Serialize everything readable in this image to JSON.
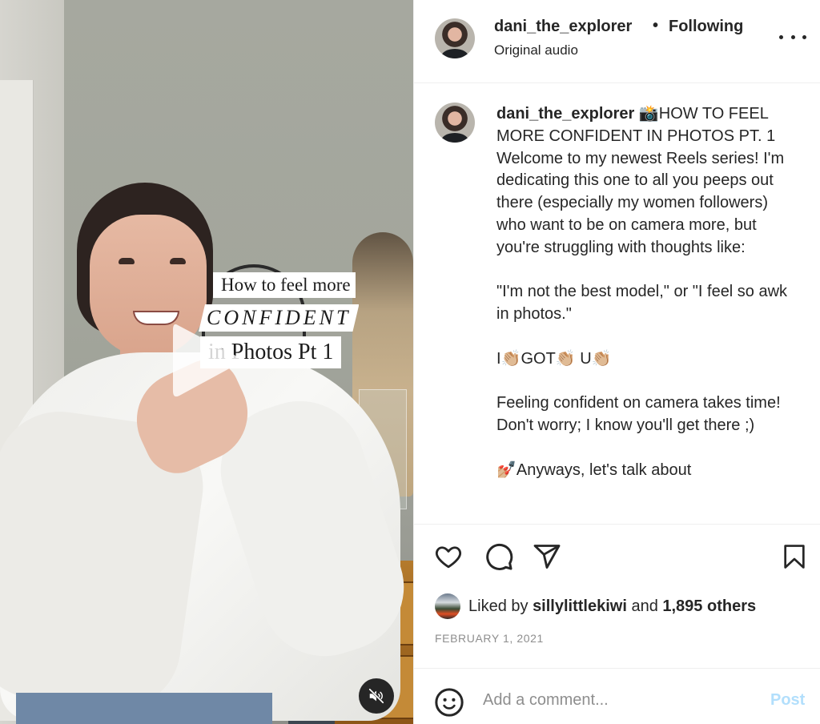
{
  "video": {
    "overlay_lines": [
      "How to feel more",
      "CONFIDENT",
      "in Photos  Pt 1"
    ],
    "play_icon": "play-icon",
    "mute_icon": "speaker-muted-icon"
  },
  "header": {
    "username": "dani_the_explorer",
    "separator": "•",
    "follow_status": "Following",
    "audio_label": "Original audio",
    "more_icon": "more-horizontal-icon"
  },
  "caption": {
    "username": "dani_the_explorer",
    "first_line": "📸HOW TO FEEL MORE CONFIDENT IN PHOTOS PT. 1",
    "paragraphs": [
      "Welcome to my newest Reels series! I'm dedicating this one to all you peeps out there (especially my women followers) who want to be on camera more, but you're struggling with thoughts like:",
      "",
      "\"I'm not the best model,\" or \"I feel so awk in photos.\"",
      "",
      "I👏🏼GOT👏🏼 U👏🏼",
      "",
      "Feeling confident on camera takes time! Don't worry; I know you'll get there ;)",
      "",
      "💅🏼Anyways, let's talk about"
    ]
  },
  "actions": {
    "like_icon": "heart-icon",
    "comment_icon": "comment-icon",
    "share_icon": "paper-plane-icon",
    "save_icon": "bookmark-icon"
  },
  "likes": {
    "prefix": "Liked by ",
    "user": "sillylittlekiwi",
    "middle": " and ",
    "count": "1,895 others"
  },
  "date": "FEBRUARY 1, 2021",
  "comment": {
    "placeholder": "Add a comment...",
    "value": "",
    "post_label": "Post",
    "emoji_icon": "smiley-icon"
  },
  "colors": {
    "text": "#262626",
    "secondary": "#8e8e8e",
    "post_disabled": "#b2dffc",
    "divider": "#efefef"
  }
}
